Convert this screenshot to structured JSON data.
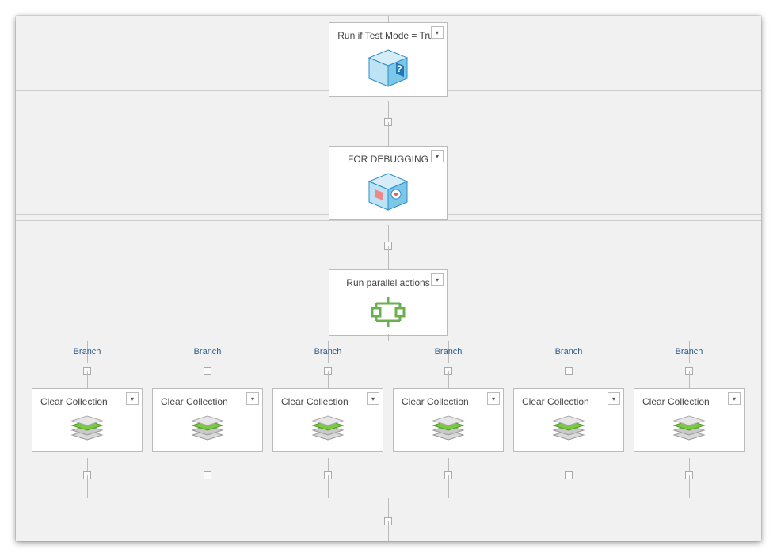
{
  "nodes": {
    "testMode": {
      "label": "Run if Test Mode = True"
    },
    "debug": {
      "label": "FOR DEBUGGING"
    },
    "parallel": {
      "label": "Run parallel actions"
    }
  },
  "branchLabel": "Branch",
  "clearCollection": {
    "label": "Clear Collection"
  },
  "branches": [
    "Branch",
    "Branch",
    "Branch",
    "Branch",
    "Branch",
    "Branch"
  ]
}
